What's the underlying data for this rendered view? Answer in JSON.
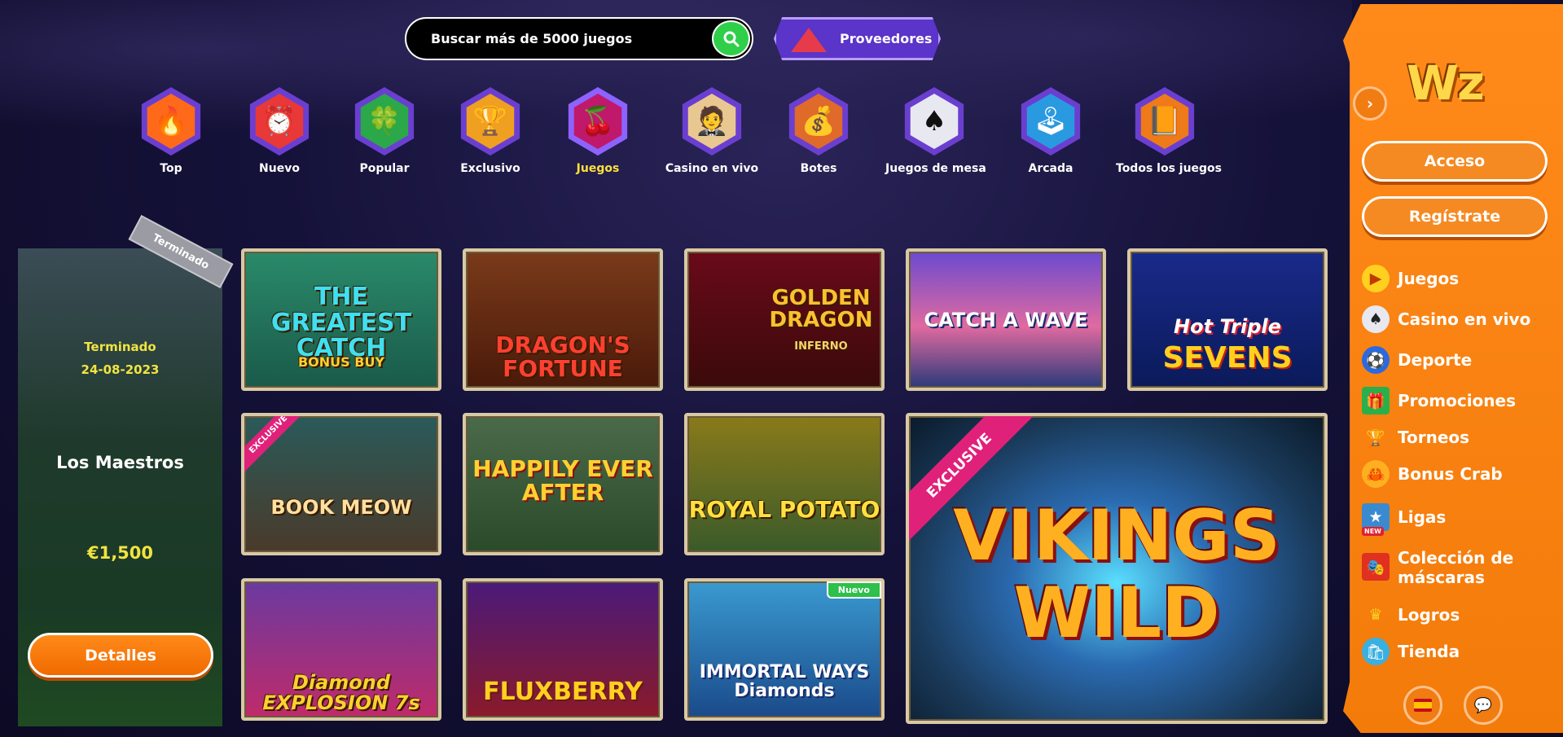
{
  "search": {
    "placeholder": "Buscar más de 5000 juegos"
  },
  "providers_label": "Proveedores",
  "categories": [
    {
      "label": "Top",
      "icon": "flame-icon",
      "glyph": "🔥"
    },
    {
      "label": "Nuevo",
      "icon": "alarm-clock-icon",
      "glyph": "⏰"
    },
    {
      "label": "Popular",
      "icon": "clover-icon",
      "glyph": "🍀"
    },
    {
      "label": "Exclusivo",
      "icon": "trophy-icon",
      "glyph": "🏆"
    },
    {
      "label": "Juegos",
      "icon": "cherries-icon",
      "glyph": "🍒"
    },
    {
      "label": "Casino en vivo",
      "icon": "dealer-icon",
      "glyph": "🤵"
    },
    {
      "label": "Botes",
      "icon": "money-bag-icon",
      "glyph": "💰"
    },
    {
      "label": "Juegos de mesa",
      "icon": "playing-card-icon",
      "glyph": "♠"
    },
    {
      "label": "Arcada",
      "icon": "joystick-icon",
      "glyph": "🕹"
    },
    {
      "label": "Todos los juegos",
      "icon": "all-games-book-icon",
      "glyph": "📙"
    }
  ],
  "active_category": "Juegos",
  "tournament": {
    "ribbon": "Terminado",
    "status": "Terminado",
    "date": "24-08-2023",
    "name": "Los Maestros",
    "prize": "€1,500",
    "button": "Detalles"
  },
  "games": [
    {
      "title": "THE GREATEST CATCH",
      "subtitle": "BONUS BUY"
    },
    {
      "title": "DRAGON'S FORTUNE",
      "subtitle": ""
    },
    {
      "title": "GOLDEN DRAGON",
      "subtitle": "INFERNO"
    },
    {
      "title": "CATCH A WAVE",
      "subtitle": ""
    },
    {
      "title": "Hot Triple",
      "subtitle": "SEVENS"
    },
    {
      "title": "BOOK MEOW",
      "subtitle": "",
      "tag": "EXCLUSIVE"
    },
    {
      "title": "HAPPILY EVER AFTER",
      "subtitle": ""
    },
    {
      "title": "ROYAL POTATO",
      "subtitle": ""
    },
    {
      "title": "VIKINGS WILD",
      "subtitle": "",
      "tag": "EXCLUSIVE"
    },
    {
      "title": "Diamond EXPLOSION 7s",
      "subtitle": ""
    },
    {
      "title": "FLUXBERRY",
      "subtitle": ""
    },
    {
      "title": "IMMORTAL WAYS Diamonds",
      "subtitle": "",
      "badge": "Nuevo"
    }
  ],
  "sidebar": {
    "logo": "Wz",
    "login": "Acceso",
    "register": "Regístrate",
    "menu": [
      {
        "label": "Juegos",
        "icon": "play-icon"
      },
      {
        "label": "Casino en vivo",
        "icon": "poker-chip-icon"
      },
      {
        "label": "Deporte",
        "icon": "soccer-ball-icon"
      },
      {
        "label": "Promociones",
        "icon": "gift-icon"
      },
      {
        "label": "Torneos",
        "icon": "trophy-icon"
      },
      {
        "label": "Bonus Crab",
        "icon": "crab-icon"
      },
      {
        "label": "Ligas",
        "icon": "leagues-icon",
        "badge": "NEW"
      },
      {
        "label": "Colección de máscaras",
        "icon": "mask-card-icon"
      },
      {
        "label": "Logros",
        "icon": "crown-icon"
      },
      {
        "label": "Tienda",
        "icon": "shop-icon"
      }
    ]
  },
  "colors": {
    "accent_orange": "#f58a22",
    "active_yellow": "#ffe23a",
    "search_green": "#2fcf4a",
    "purple": "#5b34c9"
  }
}
